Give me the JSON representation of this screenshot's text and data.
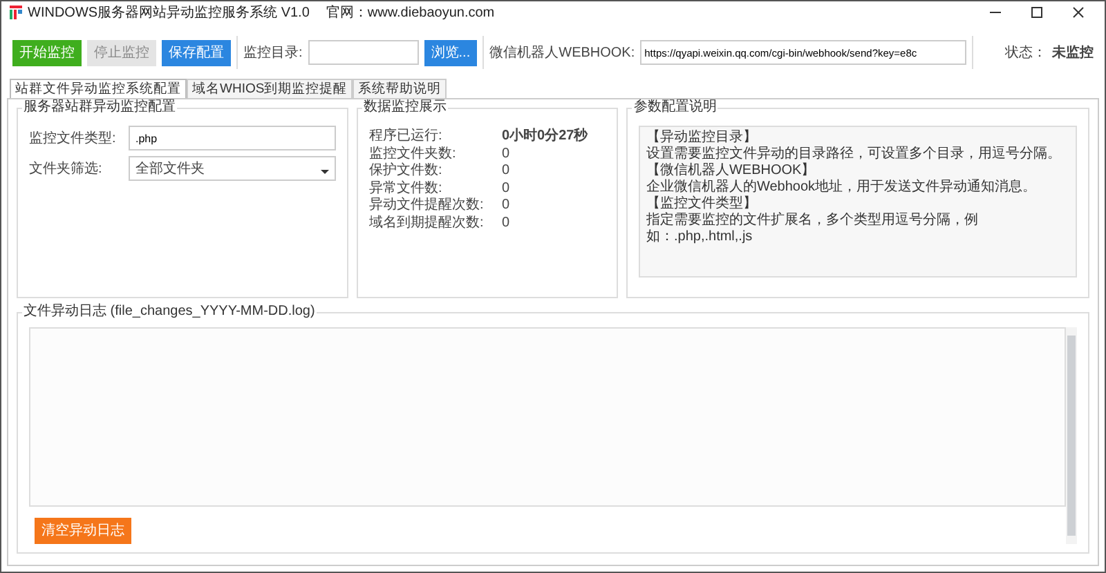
{
  "window": {
    "title": "WINDOWS服务器网站异动监控服务系统 V1.0",
    "site": "官网：www.diebaoyun.com"
  },
  "toolbar": {
    "buttons": [
      {
        "label": "开始监控",
        "kind": "start",
        "disabled": false
      },
      {
        "label": "停止监控",
        "kind": "stop",
        "disabled": true
      },
      {
        "label": "保存配置",
        "kind": "save",
        "disabled": false
      }
    ],
    "monitor_dir": {
      "label": "监控目录:",
      "browse": "浏览..."
    },
    "webhook": {
      "label": "微信机器人WEBHOOK:",
      "value": "https://qyapi.weixin.qq.com/cgi-bin/webhook/send?key=e8c"
    },
    "status": {
      "label": "状态：",
      "value": "未监控"
    }
  },
  "tabs": [
    {
      "label": "站群文件异动监控系统配置",
      "selected": true
    },
    {
      "label": "域名WHIOS到期监控提醒",
      "selected": false
    },
    {
      "label": "系统帮助说明",
      "selected": false
    }
  ],
  "config": {
    "title": "服务器站群异动监控配置",
    "fields": [
      {
        "label": "监控文件类型:",
        "value": ".php",
        "kind": "text"
      },
      {
        "label": "文件夹筛选:",
        "value": "全部文件夹",
        "kind": "select"
      }
    ]
  },
  "stats": {
    "title": "数据监控展示",
    "rows": [
      {
        "label": "程序已运行:",
        "value": "0小时0分27秒",
        "bold": true
      },
      {
        "label": "监控文件夹数:",
        "value": "0",
        "bold": false
      },
      {
        "label": "保护文件数:",
        "value": "0",
        "bold": false
      },
      {
        "label": "异常文件数:",
        "value": "0",
        "bold": false
      },
      {
        "label": "异动文件提醒次数:",
        "value": "0",
        "bold": false
      },
      {
        "label": "域名到期提醒次数:",
        "value": "0",
        "bold": false
      }
    ]
  },
  "help": {
    "title": "参数配置说明",
    "lines": [
      "【异动监控目录】",
      "设置需要监控文件异动的目录路径，可设置多个目录，用逗号分隔。",
      "【微信机器人WEBHOOK】",
      "企业微信机器人的Webhook地址，用于发送文件异动通知消息。",
      "【监控文件类型】",
      "指定需要监控的文件扩展名，多个类型用逗号分隔，例如：.php,.html,.js"
    ]
  },
  "log": {
    "title": "文件异动日志 (file_changes_YYYY-MM-DD.log)",
    "clear_button": "清空异动日志"
  }
}
